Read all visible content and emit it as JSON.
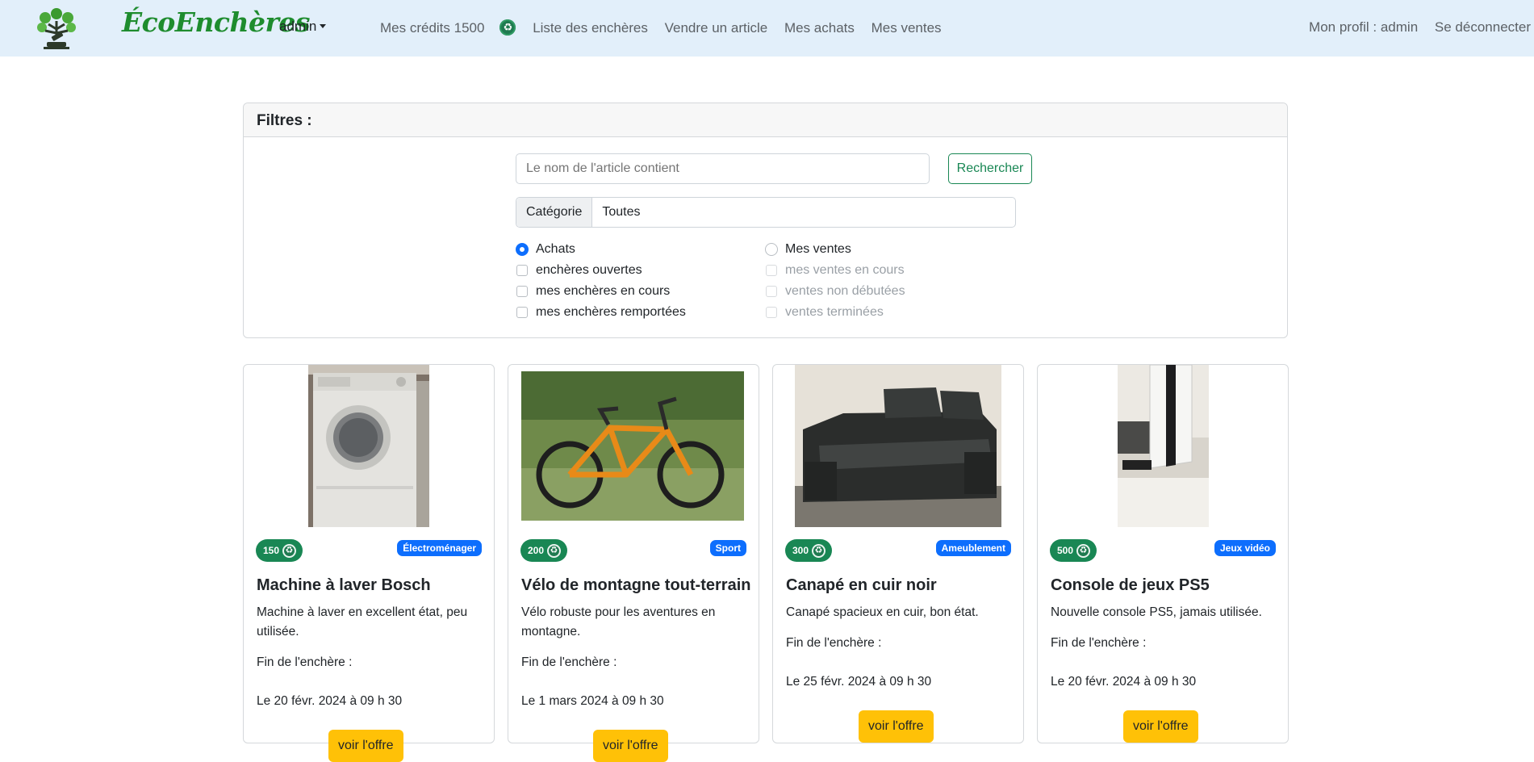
{
  "navbar": {
    "brand": "ÉcoEnchères",
    "user_menu": "admin",
    "links": {
      "credits": "Mes crédits 1500",
      "auctions_list": "Liste des enchères",
      "sell": "Vendre un article",
      "purchases": "Mes achats",
      "sales": "Mes ventes"
    },
    "profile": "Mon profil : admin",
    "logout": "Se déconnecter"
  },
  "filters": {
    "title": "Filtres :",
    "search_placeholder": "Le nom de l'article contient",
    "search_button": "Rechercher",
    "category_label": "Catégorie",
    "category_value": "Toutes",
    "purchases": {
      "label": "Achats",
      "selected": true,
      "options": [
        "enchères ouvertes",
        "mes enchères en cours",
        "mes enchères remportées"
      ]
    },
    "sales": {
      "label": "Mes ventes",
      "selected": false,
      "options": [
        "mes ventes en cours",
        "ventes non débutées",
        "ventes terminées"
      ]
    }
  },
  "cards": [
    {
      "price": "150",
      "category": "Électroménager",
      "title": "Machine à laver Bosch",
      "description": "Machine à laver en excellent état, peu utilisée.",
      "end_label": "Fin de l'enchère :",
      "end_date": "Le 20 févr. 2024 à 09 h 30",
      "button": "voir l'offre"
    },
    {
      "price": "200",
      "category": "Sport",
      "title": "Vélo de montagne tout-terrain",
      "description": "Vélo robuste pour les aventures en montagne.",
      "end_label": "Fin de l'enchère :",
      "end_date": "Le 1 mars 2024 à 09 h 30",
      "button": "voir l'offre"
    },
    {
      "price": "300",
      "category": "Ameublement",
      "title": "Canapé en cuir noir",
      "description": "Canapé spacieux en cuir, bon état.",
      "end_label": "Fin de l'enchère :",
      "end_date": "Le 25 févr. 2024 à 09 h 30",
      "button": "voir l'offre"
    },
    {
      "price": "500",
      "category": "Jeux vidéo",
      "title": "Console de jeux PS5",
      "description": "Nouvelle console PS5, jamais utilisée.",
      "end_label": "Fin de l'enchère :",
      "end_date": "Le 20 févr. 2024 à 09 h 30",
      "button": "voir l'offre"
    }
  ]
}
